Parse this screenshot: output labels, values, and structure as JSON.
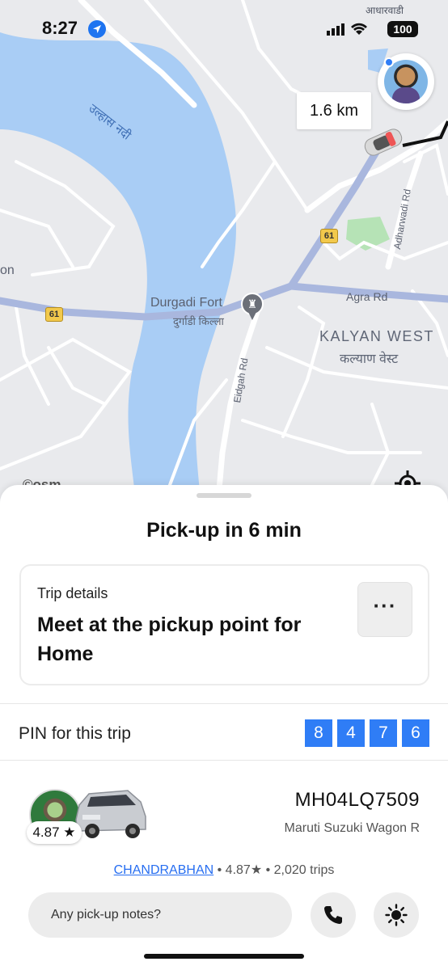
{
  "status_bar": {
    "time": "8:27",
    "battery": "100"
  },
  "map": {
    "river_label": "उल्हास नदी",
    "top_label": "आधारवाडी",
    "fort_label": "Durgadi Fort",
    "fort_label_hi": "दुर्गाडी किल्ला",
    "agra_rd": "Agra Rd",
    "eidgah_rd": "Eidgah Rd",
    "adharwadi_rd": "Adharwadi Rd",
    "kalyan_en": "KALYAN WEST",
    "kalyan_hi": "कल्याण वेस्ट",
    "partial_label": "on",
    "route_shield_1": "61",
    "route_shield_2": "61",
    "attribution": "©osm",
    "distance": "1.6 km",
    "colors": {
      "water": "#a9cdf5",
      "road_major": "#a9b7de",
      "route_line": "#111111",
      "park": "#b6e3b6"
    }
  },
  "sheet": {
    "title": "Pick-up in 6 min",
    "trip_details_label": "Trip details",
    "trip_details_text": "Meet at the pickup point for Home",
    "more_label": "···",
    "pin_label": "PIN for this trip",
    "pin_digits": [
      "8",
      "4",
      "7",
      "6"
    ],
    "driver_rating_badge": "4.87 ★",
    "plate": "MH04LQ7509",
    "vehicle_model": "Maruti Suzuki Wagon R",
    "driver_name": "CHANDRABHAN",
    "driver_stats": " • 4.87★ • 2,020 trips",
    "notes_placeholder": "Any pick-up notes?",
    "icons": {
      "call": "phone-icon",
      "light": "sun-icon",
      "more": "more-dots-icon"
    },
    "accent": "#2f7df6"
  }
}
